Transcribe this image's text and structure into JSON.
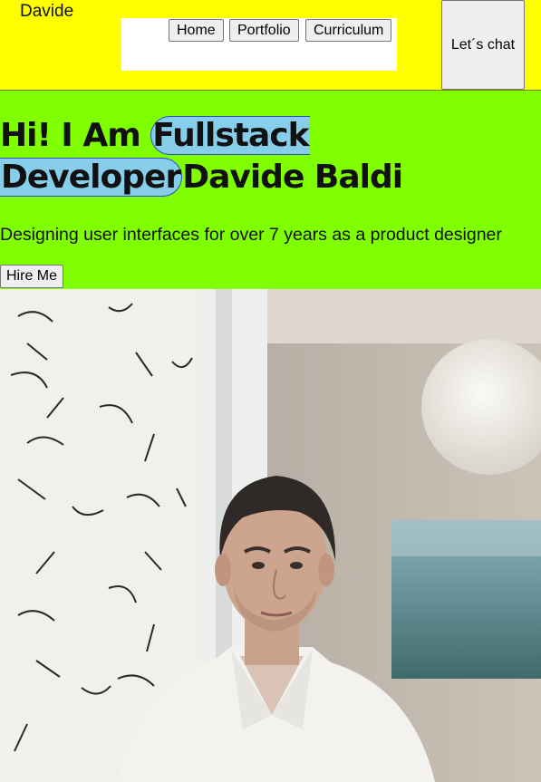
{
  "header": {
    "brand": "Davide",
    "nav": [
      "Home",
      "Portfolio",
      "Curriculum"
    ],
    "chat_label": "Let´s chat"
  },
  "hero": {
    "title_prefix": "Hi! I Am ",
    "title_highlight_1": "Fullstack",
    "title_highlight_2": "Developer",
    "title_name": "Davide Baldi",
    "subtitle": "Designing user interfaces for over 7 years as a product designer",
    "hire_label": "Hire Me"
  },
  "colors": {
    "header_bg": "#ffff00",
    "hero_bg": "#80ff00",
    "highlight": "#87ceeb"
  }
}
